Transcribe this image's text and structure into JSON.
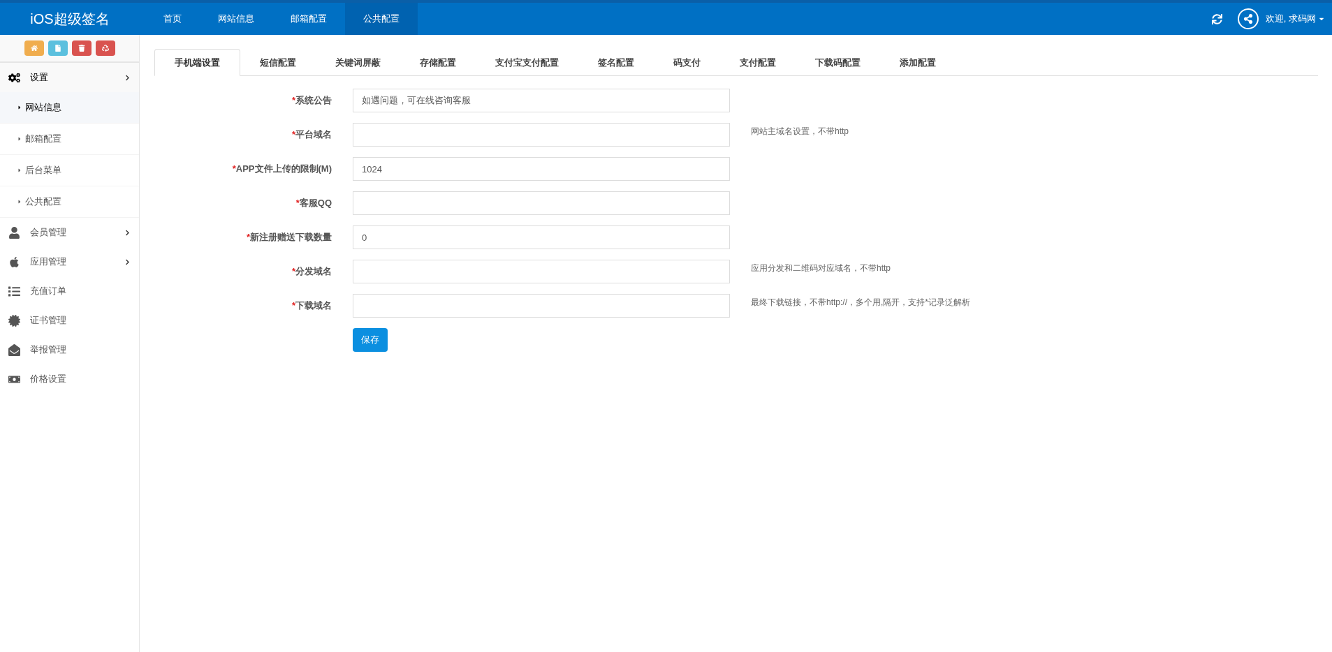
{
  "header": {
    "logo": "iOS超级签名",
    "nav": [
      {
        "label": "首页",
        "selected": false
      },
      {
        "label": "网站信息",
        "selected": false
      },
      {
        "label": "邮箱配置",
        "selected": false
      },
      {
        "label": "公共配置",
        "selected": true
      }
    ],
    "user": "欢迎, 求码网"
  },
  "sidebar": {
    "tools": [
      {
        "color": "#f0ad4e"
      },
      {
        "color": "#5bc0de"
      },
      {
        "color": "#d9534f"
      },
      {
        "color": "#d9534f"
      }
    ],
    "items": [
      {
        "label": "设置",
        "expanded": true,
        "has_children": true,
        "children": [
          {
            "label": "网站信息",
            "selected": true
          },
          {
            "label": "邮箱配置",
            "selected": false
          },
          {
            "label": "后台菜单",
            "selected": false
          },
          {
            "label": "公共配置",
            "selected": false
          }
        ]
      },
      {
        "label": "会员管理",
        "expanded": false,
        "has_children": true
      },
      {
        "label": "应用管理",
        "expanded": false,
        "has_children": true
      },
      {
        "label": "充值订单",
        "expanded": false,
        "has_children": false
      },
      {
        "label": "证书管理",
        "expanded": false,
        "has_children": false
      },
      {
        "label": "举报管理",
        "expanded": false,
        "has_children": false
      },
      {
        "label": "价格设置",
        "expanded": false,
        "has_children": false
      }
    ]
  },
  "tabs": [
    {
      "label": "手机端设置",
      "selected": true
    },
    {
      "label": "短信配置",
      "selected": false
    },
    {
      "label": "关键词屏蔽",
      "selected": false
    },
    {
      "label": "存储配置",
      "selected": false
    },
    {
      "label": "支付宝支付配置",
      "selected": false
    },
    {
      "label": "签名配置",
      "selected": false
    },
    {
      "label": "码支付",
      "selected": false
    },
    {
      "label": "支付配置",
      "selected": false
    },
    {
      "label": "下载码配置",
      "selected": false
    },
    {
      "label": "添加配置",
      "selected": false
    }
  ],
  "form": {
    "fields": [
      {
        "mark": "*",
        "label": "系统公告",
        "value": "如遇问题，可在线咨询客服"
      },
      {
        "mark": "*",
        "label": "平台域名",
        "help": "网站主域名设置，不带http"
      },
      {
        "mark": "*",
        "label": "APP文件上传的限制(M)",
        "value": "1024"
      },
      {
        "mark": "*",
        "label": "客服QQ"
      },
      {
        "mark": "*",
        "label": "新注册赠送下载数量",
        "value": "0"
      },
      {
        "mark": "*",
        "label": "分发域名",
        "help": "应用分发和二维码对应域名，不带http"
      },
      {
        "mark": "*",
        "label": "下载域名",
        "help": "最终下载链接，不带http://，多个用,隔开，支持*记录泛解析"
      }
    ],
    "submit": "保存"
  }
}
